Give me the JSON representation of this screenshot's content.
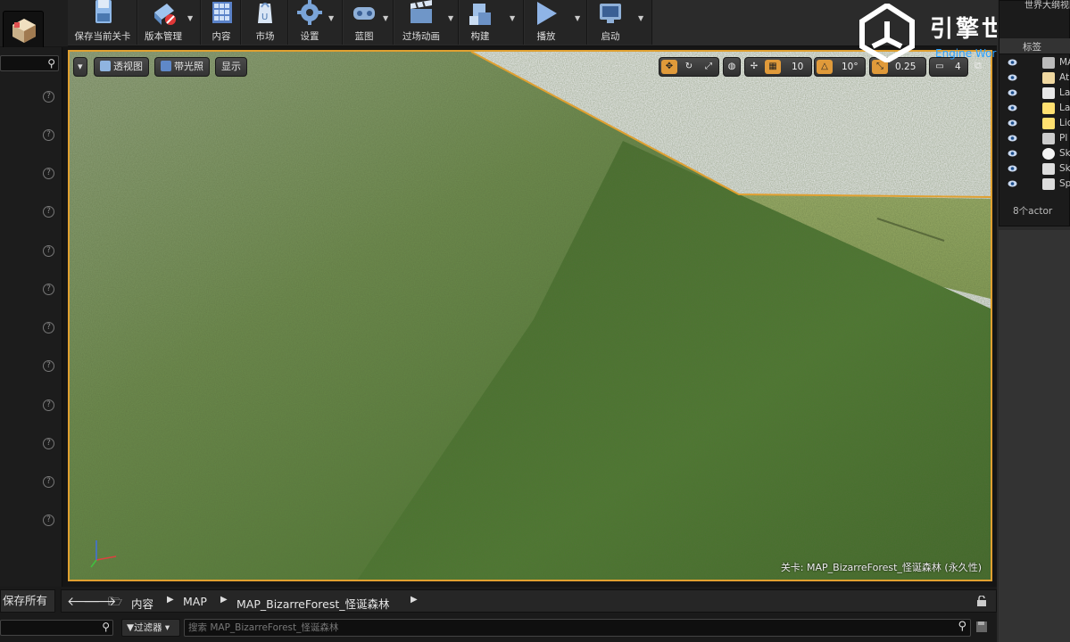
{
  "toolbar": {
    "buttons": [
      {
        "label": "保存当前关卡",
        "icon": "save-icon"
      },
      {
        "label": "版本管理",
        "icon": "source-control-icon"
      },
      {
        "label": "内容",
        "icon": "content-icon"
      },
      {
        "label": "市场",
        "icon": "marketplace-icon"
      },
      {
        "label": "设置",
        "icon": "settings-icon"
      },
      {
        "label": "蓝图",
        "icon": "blueprint-icon"
      },
      {
        "label": "过场动画",
        "icon": "cinematics-icon"
      },
      {
        "label": "构建",
        "icon": "build-icon"
      },
      {
        "label": "播放",
        "icon": "play-icon"
      },
      {
        "label": "启动",
        "icon": "launch-icon"
      }
    ]
  },
  "watermark": {
    "title": "引擎世界",
    "subtitle": "Engine World . CN"
  },
  "viewport": {
    "view_mode_buttons": [
      "透视图",
      "带光照",
      "显示"
    ],
    "grid_snap_value": "10",
    "rotation_snap_value": "10°",
    "scale_snap_value": "0.25",
    "camera_speed_value": "4",
    "level_label": "关卡: MAP_BizarreForest_怪诞森林 (永久性)"
  },
  "outliner": {
    "title": "世界大纲视图",
    "header": "标签",
    "rows": [
      {
        "label": "MAP",
        "icon": "level-icon"
      },
      {
        "label": "At",
        "icon": "atmosphere-icon"
      },
      {
        "label": "La",
        "icon": "landscape-icon"
      },
      {
        "label": "La",
        "icon": "light-icon"
      },
      {
        "label": "Lic",
        "icon": "lightmass-icon"
      },
      {
        "label": "Pl",
        "icon": "player-start-icon"
      },
      {
        "label": "Sk",
        "icon": "sky-sphere-icon"
      },
      {
        "label": "Sk",
        "icon": "skylight-icon"
      },
      {
        "label": "Sp",
        "icon": "sphere-reflection-icon"
      }
    ],
    "actor_count": "8个actor"
  },
  "content_browser": {
    "save_all_label": "保存所有",
    "breadcrumbs": [
      "内容",
      "MAP",
      "MAP_BizarreForest_怪诞森林"
    ],
    "filter_label": "过滤器",
    "search_placeholder": "搜索 MAP_BizarreForest_怪诞森林"
  },
  "colors": {
    "selection_border": "#e0a030",
    "accent": "#e09a3a",
    "watermark_blue": "#2aa0ff"
  }
}
